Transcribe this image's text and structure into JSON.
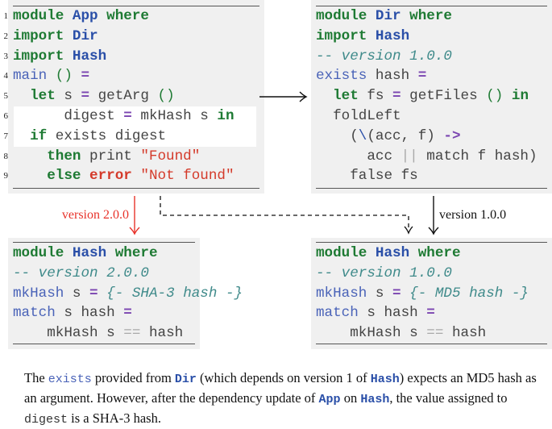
{
  "blocks": {
    "app": {
      "numbered": true,
      "lines": [
        [
          [
            "module",
            "kw"
          ],
          [
            " ",
            "plain"
          ],
          [
            "App",
            "mod"
          ],
          [
            " ",
            "plain"
          ],
          [
            "where",
            "kw"
          ]
        ],
        [
          [
            "import",
            "kw"
          ],
          [
            " ",
            "plain"
          ],
          [
            "Dir",
            "mod"
          ]
        ],
        [
          [
            "import",
            "kw"
          ],
          [
            " ",
            "plain"
          ],
          [
            "Hash",
            "mod"
          ]
        ],
        [
          [
            "main",
            "fn"
          ],
          [
            " ",
            "plain"
          ],
          [
            "()",
            "par"
          ],
          [
            " ",
            "plain"
          ],
          [
            "=",
            "op"
          ]
        ],
        [
          [
            "  ",
            "plain"
          ],
          [
            "let",
            "kw"
          ],
          [
            " s ",
            "plain"
          ],
          [
            "=",
            "op"
          ],
          [
            " getArg ",
            "plain"
          ],
          [
            "()",
            "par"
          ]
        ],
        [
          [
            "      digest ",
            "plain"
          ],
          [
            "=",
            "op"
          ],
          [
            " mkHash s ",
            "plain"
          ],
          [
            "in",
            "kw"
          ]
        ],
        [
          [
            "  ",
            "plain"
          ],
          [
            "if",
            "kw"
          ],
          [
            " exists digest",
            "plain"
          ]
        ],
        [
          [
            "    ",
            "plain"
          ],
          [
            "then",
            "kw"
          ],
          [
            " print ",
            "plain"
          ],
          [
            "\"Found\"",
            "str"
          ]
        ],
        [
          [
            "    ",
            "plain"
          ],
          [
            "else",
            "kw"
          ],
          [
            " ",
            "plain"
          ],
          [
            "error",
            "err"
          ],
          [
            " ",
            "plain"
          ],
          [
            "\"Not found\"",
            "str"
          ]
        ]
      ]
    },
    "dir": {
      "lines": [
        [
          [
            "module",
            "kw"
          ],
          [
            " ",
            "plain"
          ],
          [
            "Dir",
            "mod"
          ],
          [
            " ",
            "plain"
          ],
          [
            "where",
            "kw"
          ]
        ],
        [
          [
            "import",
            "kw"
          ],
          [
            " ",
            "plain"
          ],
          [
            "Hash",
            "mod"
          ]
        ],
        [
          [
            "-- version 1.0.0",
            "cm"
          ]
        ],
        [
          [
            "exists",
            "fn"
          ],
          [
            " hash ",
            "plain"
          ],
          [
            "=",
            "op"
          ]
        ],
        [
          [
            "  ",
            "plain"
          ],
          [
            "let",
            "kw"
          ],
          [
            " fs ",
            "plain"
          ],
          [
            "=",
            "op"
          ],
          [
            " getFiles ",
            "plain"
          ],
          [
            "()",
            "par"
          ],
          [
            " ",
            "plain"
          ],
          [
            "in",
            "kw"
          ]
        ],
        [
          [
            "  foldLeft",
            "plain"
          ]
        ],
        [
          [
            "    (",
            "plain"
          ],
          [
            "\\",
            "lam"
          ],
          [
            "(acc, f) ",
            "plain"
          ],
          [
            "->",
            "op"
          ]
        ],
        [
          [
            "      acc ",
            "plain"
          ],
          [
            "||",
            "faint"
          ],
          [
            " match f hash)",
            "plain"
          ]
        ],
        [
          [
            "    false fs",
            "plain"
          ]
        ]
      ]
    },
    "hash2": {
      "lines": [
        [
          [
            "module",
            "kw"
          ],
          [
            " ",
            "plain"
          ],
          [
            "Hash",
            "mod"
          ],
          [
            " ",
            "plain"
          ],
          [
            "where",
            "kw"
          ]
        ],
        [
          [
            "-- version 2.0.0",
            "cm"
          ]
        ],
        [
          [
            "mkHash",
            "fn"
          ],
          [
            " s ",
            "plain"
          ],
          [
            "=",
            "op"
          ],
          [
            " ",
            "plain"
          ],
          [
            "{- SHA-3 hash -}",
            "cm"
          ]
        ],
        [
          [
            "match",
            "fn"
          ],
          [
            " s hash ",
            "plain"
          ],
          [
            "=",
            "op"
          ]
        ],
        [
          [
            "    mkHash s ",
            "plain"
          ],
          [
            "==",
            "faint"
          ],
          [
            " hash",
            "plain"
          ]
        ]
      ]
    },
    "hash1": {
      "lines": [
        [
          [
            "module",
            "kw"
          ],
          [
            " ",
            "plain"
          ],
          [
            "Hash",
            "mod"
          ],
          [
            " ",
            "plain"
          ],
          [
            "where",
            "kw"
          ]
        ],
        [
          [
            "-- version 1.0.0",
            "cm"
          ]
        ],
        [
          [
            "mkHash",
            "fn"
          ],
          [
            " s ",
            "plain"
          ],
          [
            "=",
            "op"
          ],
          [
            " ",
            "plain"
          ],
          [
            "{- MD5 hash -}",
            "cm"
          ]
        ],
        [
          [
            "match",
            "fn"
          ],
          [
            " s hash ",
            "plain"
          ],
          [
            "=",
            "op"
          ]
        ],
        [
          [
            "    mkHash s ",
            "plain"
          ],
          [
            "==",
            "faint"
          ],
          [
            " hash",
            "plain"
          ]
        ]
      ]
    }
  },
  "arrows": {
    "left_label": "version 2.0.0",
    "right_label": "version 1.0.0",
    "red": "#e8322a",
    "black": "#111111"
  },
  "caption": [
    [
      "The ",
      "t"
    ],
    [
      "exists",
      "cfn"
    ],
    [
      " provided from ",
      "t"
    ],
    [
      "Dir",
      "cmod"
    ],
    [
      " (which depends on version 1 of ",
      "t"
    ],
    [
      "Hash",
      "cmod"
    ],
    [
      ") expects an MD5 hash as an argument. However, after the dependency update of ",
      "t"
    ],
    [
      "App",
      "cmod"
    ],
    [
      " on ",
      "t"
    ],
    [
      "Hash",
      "cmod"
    ],
    [
      ", the value assigned to ",
      "t"
    ],
    [
      "digest",
      "cplain"
    ],
    [
      " is a SHA-3 hash.",
      "t"
    ]
  ]
}
